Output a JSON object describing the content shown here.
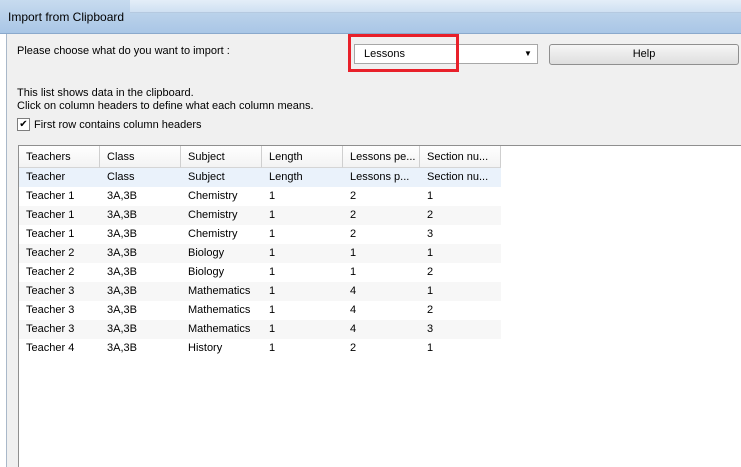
{
  "window": {
    "title": "Import from Clipboard"
  },
  "prompt": {
    "label": "Please choose what do you want to import :"
  },
  "import_type": {
    "selected": "Lessons"
  },
  "help_button": {
    "label": "Help"
  },
  "info": {
    "line1": "This list shows data in the clipboard.",
    "line2": "Click on column headers to define what each column means."
  },
  "first_row_headers": {
    "label": "First row contains column headers",
    "checked": true
  },
  "columns": [
    "Teachers",
    "Class",
    "Subject",
    "Length",
    "Lessons pe...",
    "Section nu..."
  ],
  "rows": [
    [
      "Teacher",
      "Class",
      "Subject",
      "Length",
      "Lessons p...",
      "Section nu..."
    ],
    [
      "Teacher 1",
      "3A,3B",
      "Chemistry",
      "1",
      "2",
      "1"
    ],
    [
      "Teacher 1",
      "3A,3B",
      "Chemistry",
      "1",
      "2",
      "2"
    ],
    [
      "Teacher 1",
      "3A,3B",
      "Chemistry",
      "1",
      "2",
      "3"
    ],
    [
      "Teacher 2",
      "3A,3B",
      "Biology",
      "1",
      "1",
      "1"
    ],
    [
      "Teacher 2",
      "3A,3B",
      "Biology",
      "1",
      "1",
      "2"
    ],
    [
      "Teacher 3",
      "3A,3B",
      "Mathematics",
      "1",
      "4",
      "1"
    ],
    [
      "Teacher 3",
      "3A,3B",
      "Mathematics",
      "1",
      "4",
      "2"
    ],
    [
      "Teacher 3",
      "3A,3B",
      "Mathematics",
      "1",
      "4",
      "3"
    ],
    [
      "Teacher 4",
      "3A,3B",
      "History",
      "1",
      "2",
      "1"
    ]
  ]
}
